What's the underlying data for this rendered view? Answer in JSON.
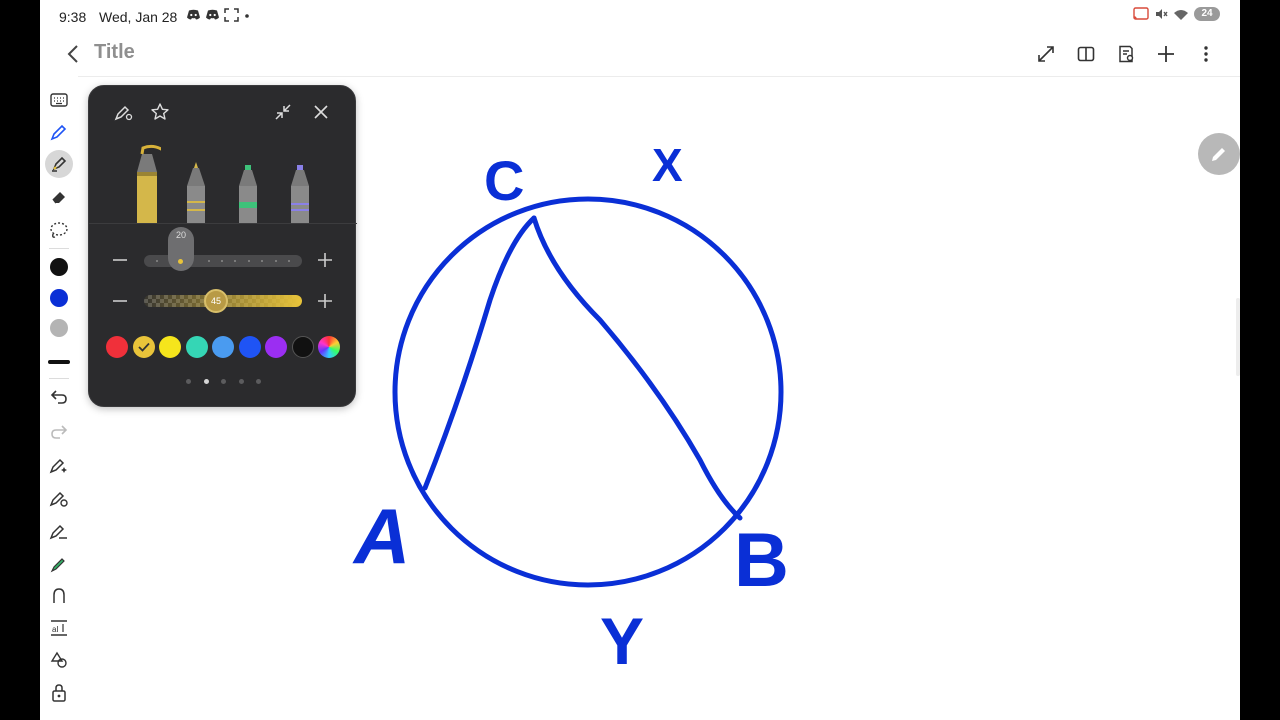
{
  "status": {
    "time": "9:38",
    "date": "Wed, Jan 28",
    "left_icons": [
      "discord-icon",
      "discord-icon",
      "screenshot-frame-icon",
      "dot-icon"
    ],
    "right_icons": [
      "cast-icon",
      "mute-icon",
      "wifi-icon",
      "battery-icon"
    ],
    "battery": "24"
  },
  "header": {
    "title": "Title",
    "actions": [
      "expand-icon",
      "book-view-icon",
      "settings-page-icon",
      "plus-icon",
      "more-vertical-icon"
    ]
  },
  "toolbar": {
    "tools": [
      "keyboard-icon",
      "pen-icon",
      "highlighter-icon",
      "eraser-icon",
      "lasso-icon",
      "swatch-black",
      "swatch-blue",
      "swatch-gray",
      "line-thickness-icon",
      "undo-icon",
      "redo-icon",
      "ai-pen-icon",
      "shape-pen-icon",
      "text-pen-icon",
      "marker-icon",
      "shape-icon",
      "text-box-icon",
      "shapes-fill-icon",
      "lock-icon"
    ],
    "active_tool": "highlighter-icon",
    "colors": {
      "black": "#111111",
      "blue": "#0a2fd6",
      "gray": "#b4b4b4"
    }
  },
  "pen_panel": {
    "size_value": "20",
    "opacity_value": "45",
    "active_color": "#e9c43a",
    "colors": [
      "#f0303a",
      "#e9c43a",
      "#f5e51c",
      "#35d6b5",
      "#4a9bf0",
      "#1f54f5",
      "#9b2ef2",
      "#111111",
      "rainbow"
    ],
    "selected_color_index": 1,
    "pages": 5,
    "current_page": 1
  },
  "drawing": {
    "ink_color": "#0a2fd6",
    "labels": {
      "c": "C",
      "x": "X",
      "a": "A",
      "b": "B",
      "y": "Y"
    }
  }
}
